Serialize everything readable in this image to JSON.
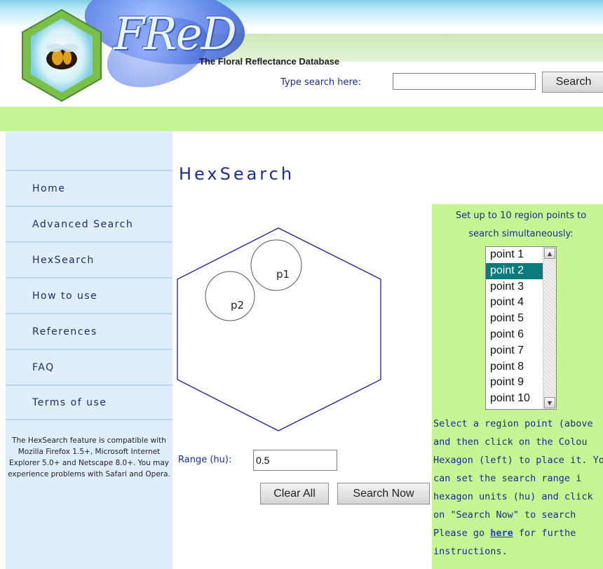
{
  "header": {
    "logo_text": "FReD",
    "tagline": "The Floral Reflectance Database",
    "search_label": "Type search here:",
    "search_value": "",
    "search_button": "Search"
  },
  "sidebar": {
    "nav": [
      "Home",
      "Advanced Search",
      "HexSearch",
      "How to use",
      "References",
      "FAQ",
      "Terms of use"
    ],
    "compat_note": "The HexSearch feature is compatible with Mozilla Firefox 1.5+, Microsoft Internet Explorer 5.0+ and Netscape 8.0+. You may experience problems with Safari and Opera."
  },
  "main": {
    "title": "HexSearch",
    "points": [
      {
        "label": "p1"
      },
      {
        "label": "p2"
      }
    ],
    "range_label": "Range (hu):",
    "range_value": "0.5",
    "clear_button": "Clear All",
    "search_now_button": "Search Now"
  },
  "panel": {
    "intro_line1": "Set up to 10 region points to",
    "intro_line2": "search simultaneously:",
    "points_list": [
      "point 1",
      "point 2",
      "point 3",
      "point 4",
      "point 5",
      "point 6",
      "point 7",
      "point 8",
      "point 9",
      "point 10"
    ],
    "selected_point": "point 2",
    "instr_1": "Select a region point (above",
    "instr_2": "and then click on the Colou",
    "instr_3": "Hexagon (left) to place it. Yo",
    "instr_4": "can set the search range i",
    "instr_5": "hexagon units (hu) and click",
    "instr_6": "on \"Search Now\" to search",
    "instr_7a": "Please go ",
    "instr_link": "here",
    "instr_7b": " for furthe",
    "instr_8": "instructions."
  },
  "colors": {
    "accent_green": "#c6f593",
    "sidebar_blue": "#e0eefb",
    "link_blue": "#1d2c8f",
    "hexagon_stroke": "#1a1ab0",
    "selected_teal": "#0b7a7a"
  },
  "icons": [
    "bee-logo-icon",
    "scroll-up-icon",
    "scroll-down-icon"
  ]
}
